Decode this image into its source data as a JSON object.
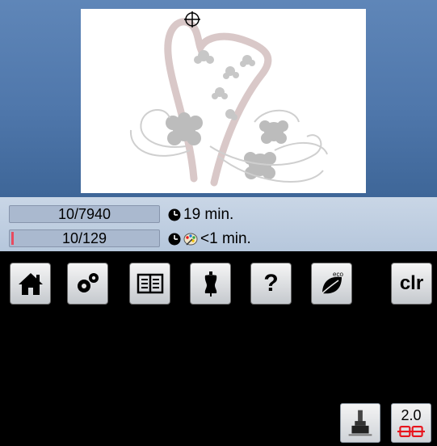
{
  "status": {
    "stitch_counter": "10/7940",
    "color_counter": "10/129",
    "total_time": "19 min.",
    "color_time": "<1 min."
  },
  "size_button": {
    "value": "2.0"
  },
  "nav": {
    "clear_label": "clr",
    "eco_label": "eco",
    "help_label": "?"
  },
  "icons": {
    "clock": "clock-icon",
    "palette": "palette-icon",
    "edit": "presser-foot-icon",
    "size": "hoop-frame-icon",
    "home": "home-icon",
    "settings": "gears-icon",
    "tutorial": "book-icon",
    "creative_consultant": "dress-form-icon",
    "help": "question-icon",
    "eco": "leaf-icon"
  },
  "colors": {
    "hoop_background": "#5b82b5",
    "status_background": "#c4d1e2",
    "accent_red": "#e8141c"
  }
}
